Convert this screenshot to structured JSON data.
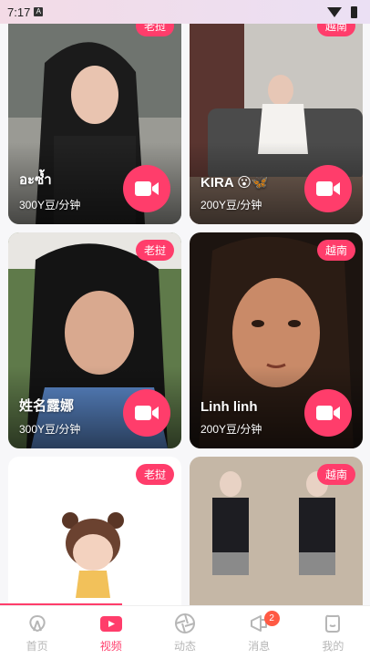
{
  "status": {
    "time": "7:17",
    "a_label": "A"
  },
  "cards": [
    {
      "tag": "老挝",
      "name": "อะซ้ำ",
      "price": "300Y豆/分钟"
    },
    {
      "tag": "越南",
      "name": "KIRA 😮🦋",
      "price": "200Y豆/分钟"
    },
    {
      "tag": "老挝",
      "name": "姓名露娜",
      "price": "300Y豆/分钟"
    },
    {
      "tag": "越南",
      "name": "Linh linh",
      "price": "200Y豆/分钟"
    },
    {
      "tag": "老挝",
      "name": "",
      "price": ""
    },
    {
      "tag": "越南",
      "name": "",
      "price": ""
    }
  ],
  "tabs": [
    {
      "label": "首页",
      "icon": "home-icon"
    },
    {
      "label": "视频",
      "icon": "video-icon"
    },
    {
      "label": "动态",
      "icon": "camera-aperture-icon"
    },
    {
      "label": "消息",
      "icon": "megaphone-icon",
      "badge": "2"
    },
    {
      "label": "我的",
      "icon": "profile-icon"
    }
  ],
  "colors": {
    "accent": "#ff3d6b",
    "badge": "#ff5a44",
    "inactive": "#b6b6b6"
  }
}
